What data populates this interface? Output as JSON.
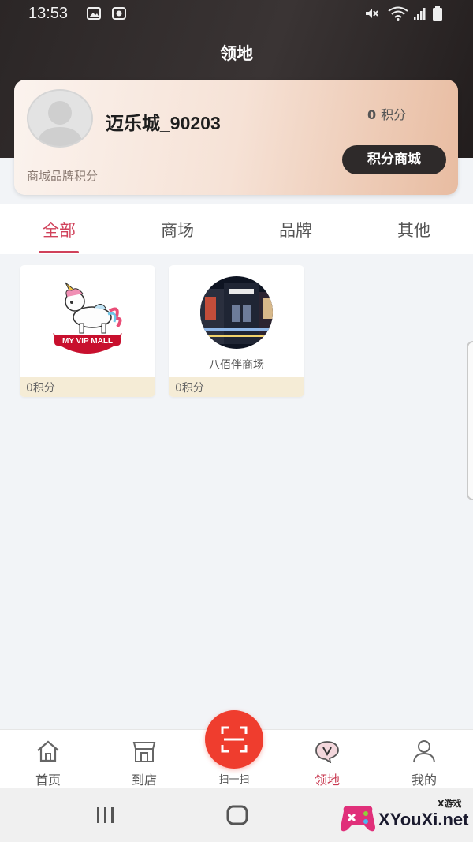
{
  "status_bar": {
    "time": "13:53"
  },
  "header": {
    "title": "领地"
  },
  "profile": {
    "username": "迈乐城_90203",
    "points_value": "0",
    "points_unit": "积分",
    "mall_button": "积分商城",
    "subtitle": "商城品牌积分"
  },
  "tabs": [
    {
      "label": "全部",
      "active": true
    },
    {
      "label": "商场",
      "active": false
    },
    {
      "label": "品牌",
      "active": false
    },
    {
      "label": "其他",
      "active": false
    }
  ],
  "items": [
    {
      "name": "",
      "logo_text": "MY VIP MALL",
      "points": "0积分"
    },
    {
      "name": "八佰伴商场",
      "logo_text": "",
      "points": "0积分"
    }
  ],
  "tabbar": {
    "home": "首页",
    "store": "到店",
    "scan": "扫一扫",
    "territory": "领地",
    "mine": "我的",
    "active": "territory"
  },
  "watermark": {
    "text": "XYouXi.net",
    "small": "X游戏"
  },
  "colors": {
    "accent": "#d0415a",
    "scan": "#ef3d2e",
    "header_bg": "#2b2626"
  }
}
